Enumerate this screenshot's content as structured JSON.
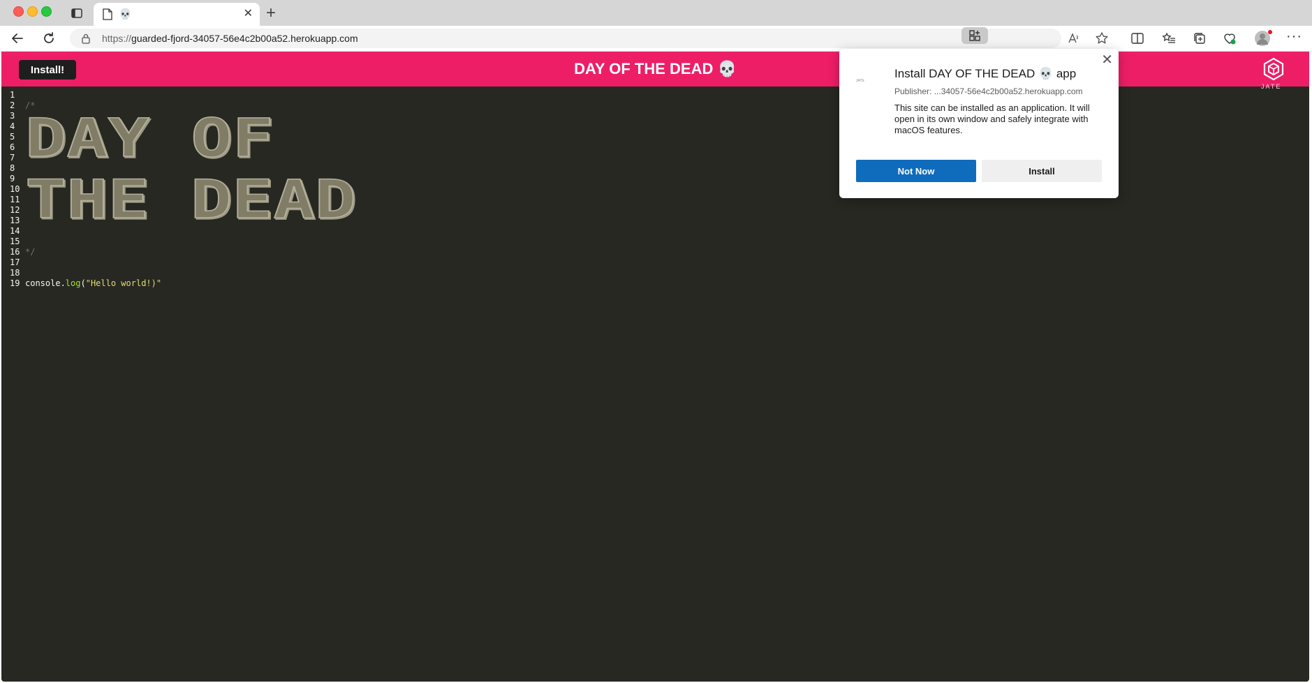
{
  "browser": {
    "tab": {
      "title": "💀",
      "close_glyph": "✕",
      "icon": "document-icon"
    },
    "new_tab_glyph": "+",
    "url_scheme": "https://",
    "url_host": "guarded-fjord-34057-56e4c2b00a52.herokuapp.com",
    "more_glyph": "···"
  },
  "header": {
    "install_label": "Install!",
    "title": "DAY OF THE DEAD 💀",
    "logo_text": "JATE",
    "color": "#ed1e66"
  },
  "editor": {
    "line_numbers": [
      "1",
      "2",
      "3",
      "4",
      "5",
      "6",
      "7",
      "8",
      "9",
      "10",
      "11",
      "12",
      "13",
      "14",
      "15",
      "16",
      "17",
      "18",
      "19"
    ],
    "comment_open": "/*",
    "comment_close": "*/",
    "ascii_art_line1": "DAY OF",
    "ascii_art_line2": "THE DEAD",
    "code_object": "console.",
    "code_fn": "log",
    "code_paren_open": "(",
    "code_string": "\"Hello world!)\"",
    "background": "#272822"
  },
  "popup": {
    "title": "Install DAY OF THE DEAD 💀 app",
    "publisher": "Publisher: ...34057-56e4c2b00a52.herokuapp.com",
    "description": "This site can be installed as an application. It will open in its own window and safely integrate with macOS features.",
    "not_now_label": "Not Now",
    "install_label": "Install",
    "icon_text": "JATE",
    "accent": "#0f6cbd"
  }
}
